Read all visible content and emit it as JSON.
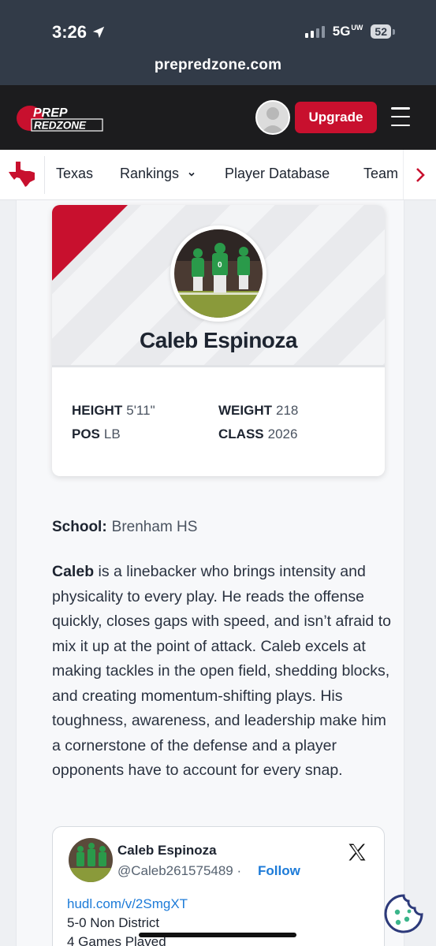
{
  "status_bar": {
    "time": "3:26",
    "network": "5G",
    "network_sup": "UW",
    "battery": "52"
  },
  "browser": {
    "url": "prepredzone.com"
  },
  "header": {
    "logo_top": "PREP",
    "logo_bottom": "REDZONE",
    "upgrade_label": "Upgrade"
  },
  "nav": {
    "items": [
      "Texas",
      "Rankings",
      "Player Database",
      "Team"
    ]
  },
  "player": {
    "name": "Caleb Espinoza",
    "stats": {
      "height_label": "HEIGHT",
      "height_value": "5'11\"",
      "weight_label": "WEIGHT",
      "weight_value": "218",
      "pos_label": "POS",
      "pos_value": "LB",
      "class_label": "CLASS",
      "class_value": "2026"
    },
    "school_label": "School:",
    "school_value": "Brenham HS",
    "bio_name": "Caleb",
    "bio_text": " is a linebacker who brings intensity and physicality to every play. He reads the offense quickly, closes gaps with speed, and isn’t afraid to mix it up at the point of attack. Caleb excels at making tackles in the open field, shedding blocks, and creating momentum-shifting plays. His toughness, awareness, and leadership make him a cornerstone of the defense and a player opponents have to account for every snap."
  },
  "tweet": {
    "name": "Caleb Espinoza",
    "handle": "@Caleb261575489",
    "separator": "·",
    "follow_label": "Follow",
    "link": "hudl.com/v/2SmgXT",
    "lines": [
      "5-0 Non District",
      "4 Games Played"
    ]
  },
  "colors": {
    "brand_red": "#c8102e",
    "header_bg": "#1c1c1e",
    "link_blue": "#1d7bd8"
  }
}
